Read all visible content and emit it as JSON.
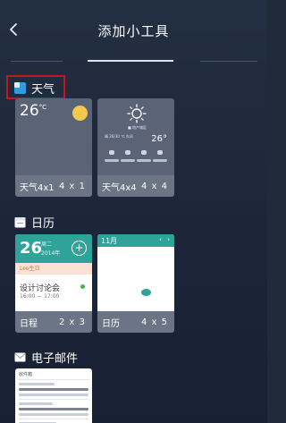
{
  "header": {
    "title": "添加小工具",
    "back_icon": "chevron-left-icon"
  },
  "sections": {
    "weather": {
      "label": "天气",
      "icon": "weather-app-icon",
      "icon_color": "#2f9be0"
    },
    "calendar": {
      "label": "日历",
      "icon": "calendar-app-icon"
    },
    "email": {
      "label": "电子邮件",
      "icon": "email-app-icon"
    }
  },
  "widgets": {
    "weather_small": {
      "name": "天气4x1",
      "size": "4 x 1",
      "temp": "26",
      "unit": "°C"
    },
    "weather_big": {
      "name": "天气4x4",
      "size": "4 x 4",
      "temp": "26°",
      "city": "■ 地产城区",
      "cond": "晴 26/30 ℃ 东风"
    },
    "calendar_small": {
      "name": "日程",
      "size": "2 x 3",
      "day": "26",
      "weekday": "周二",
      "year": "2014年",
      "tag": "Lee生日",
      "event": "设计讨论会",
      "time": "16:00 — 17:00"
    },
    "calendar_big": {
      "name": "日历",
      "size": "4 x 5",
      "month": "11月",
      "nav": "‹ ›"
    },
    "email_small": {
      "name": "收件箱"
    }
  },
  "colors": {
    "highlight_border": "#c8141c",
    "calendar_accent": "#2fa39a",
    "card_footer": "#6c7585"
  }
}
